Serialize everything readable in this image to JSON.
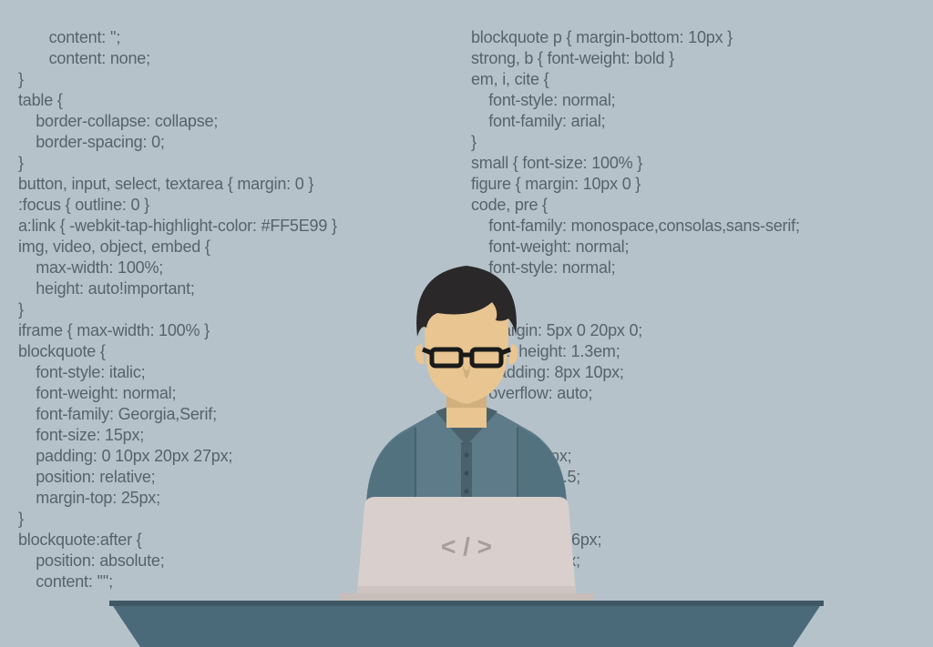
{
  "colors": {
    "background": "#b6c2ca",
    "codeText": "#57636b",
    "desk": "#4b6a79",
    "laptopBody": "#d9d0cd",
    "shirt": "#5d7b88",
    "shirtDark": "#4a616c",
    "skin": "#e8c591",
    "skinShadow": "#d1af7f",
    "hair": "#2a2828",
    "glasses": "#1a1a1a",
    "laptopSymbol": "#a79d99"
  },
  "laptopSymbol": "< / >",
  "codeLeft": "       content: '';\n       content: none;\n}\ntable {\n    border-collapse: collapse;\n    border-spacing: 0;\n}\nbutton, input, select, textarea { margin: 0 }\n:focus { outline: 0 }\na:link { -webkit-tap-highlight-color: #FF5E99 }\nimg, video, object, embed {\n    max-width: 100%;\n    height: auto!important;\n}\niframe { max-width: 100% }\nblockquote {\n    font-style: italic;\n    font-weight: normal;\n    font-family: Georgia,Serif;\n    font-size: 15px;\n    padding: 0 10px 20px 27px;\n    position: relative;\n    margin-top: 25px;\n}\nblockquote:after {\n    position: absolute;\n    content: '\"';",
  "codeRight": "blockquote p { margin-bottom: 10px }\nstrong, b { font-weight: bold }\nem, i, cite {\n    font-style: normal;\n    font-family: arial;\n}\nsmall { font-size: 100% }\nfigure { margin: 10px 0 }\ncode, pre {\n    font-family: monospace,consolas,sans-serif;\n    font-weight: normal;\n    font-style: normal;\n}\npre {\n    margin: 5px 0 20px 0;\n    line-height: 1.3em;\n    padding: 8px 10px;\n    overflow: auto;\n}\n      {\n         g: 0 8px;\n         eight: 1.5;\n}\n\n              : 1px 6px;\n               0 2px;\n              ack;"
}
